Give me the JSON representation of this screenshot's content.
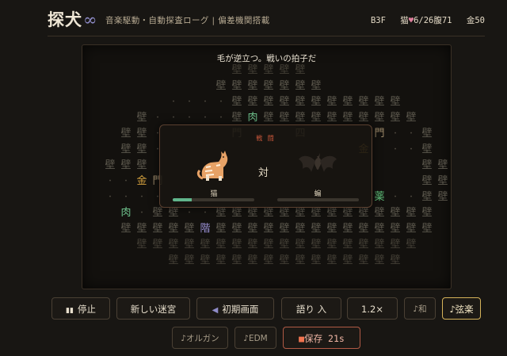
{
  "header": {
    "logo_text": "探犬",
    "logo_mark": "∞",
    "subtitle": "音楽駆動・自動探査ローグ | 偏差機関搭載",
    "floor": "B3F",
    "pet_label": "猫",
    "hp": "6/26",
    "hunger_label": "腹71",
    "gold_label": "金50"
  },
  "game": {
    "message": "毛が逆立つ。戦いの拍子だ",
    "battle": {
      "title": "戦 闘",
      "vs": "対",
      "player_name": "猫",
      "enemy_name": "蝙",
      "player_hp_fraction": 0.23,
      "enemy_hp_fraction": 0.0
    }
  },
  "controls": {
    "stop": "停止",
    "new_maze": "新しい迷宮",
    "title_screen": "初期画面",
    "narrate": "語り 入",
    "speed": "1.2×",
    "music_wa": "♪和",
    "music_strings": "♪弦楽",
    "music_organ": "♪オルガン",
    "music_edm": "♪EDM",
    "save": "保存 21s"
  },
  "icons": {
    "pause": "pause-icon",
    "back": "triangle-left-icon",
    "save": "square-icon",
    "heart": "heart-icon"
  },
  "colors": {
    "gold_tile": "#d4a13f",
    "meat_tile": "#6fc38d",
    "stairs_tile": "#9b91d6",
    "accent_active": "#d6b35a",
    "save_accent": "#b05a45"
  }
}
